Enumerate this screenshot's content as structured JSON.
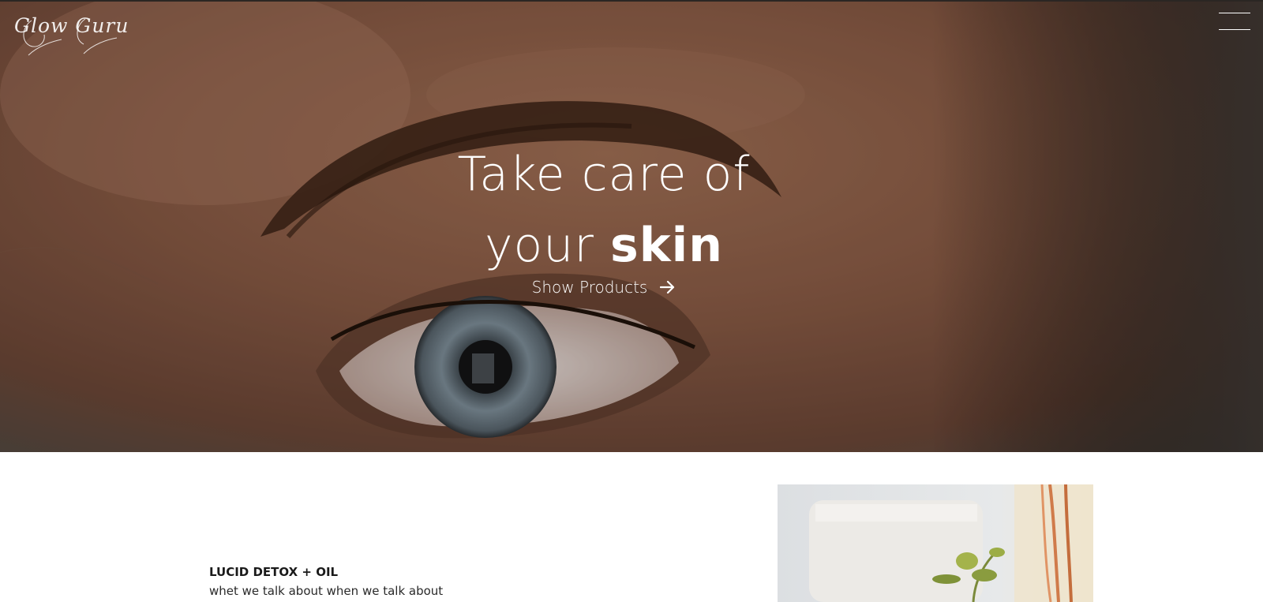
{
  "header": {
    "logo_text": "Glow Guru",
    "menu_icon": "hamburger-menu-icon"
  },
  "hero": {
    "title_line1": "Take care of",
    "title_line2_prefix": "your ",
    "title_line2_bold": "skin",
    "cta_label": "Show Products",
    "cta_icon": "arrow-right-icon"
  },
  "product": {
    "title": "LUCID DETOX + OIL",
    "description": "whet we talk about when we talk about"
  }
}
